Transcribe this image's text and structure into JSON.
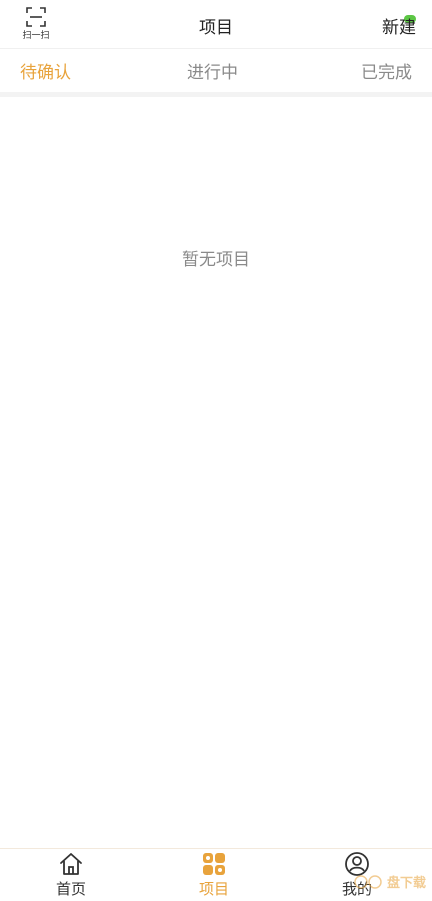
{
  "header": {
    "scan_label": "扫一扫",
    "title": "项目",
    "new_label": "新建"
  },
  "tabs": [
    {
      "label": "待确认",
      "active": true
    },
    {
      "label": "进行中",
      "active": false
    },
    {
      "label": "已完成",
      "active": false
    }
  ],
  "empty_text": "暂无项目",
  "bottom_nav": [
    {
      "label": "首页",
      "icon": "home-icon",
      "active": false
    },
    {
      "label": "项目",
      "icon": "grid-icon",
      "active": true
    },
    {
      "label": "我的",
      "icon": "user-icon",
      "active": false
    }
  ],
  "watermark": {
    "text": "盘下载"
  },
  "colors": {
    "accent": "#e8a33c",
    "badge": "#5cc645",
    "muted": "#8a8a8a"
  }
}
